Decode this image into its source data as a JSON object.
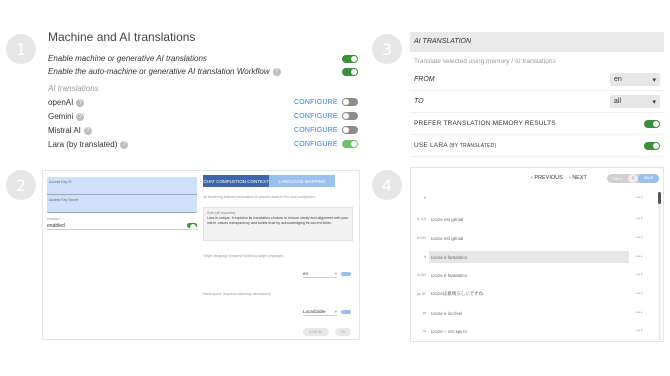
{
  "steps": [
    "1",
    "2",
    "3",
    "4"
  ],
  "panel1": {
    "title": "Machine and AI translations",
    "enable_machine": "Enable machine or generative AI translations",
    "enable_auto": "Enable the auto-machine or generative AI translation Workflow",
    "section": "AI translations",
    "providers": [
      {
        "name": "openAI",
        "action": "CONFIGURE",
        "enabled": false
      },
      {
        "name": "Gemini",
        "action": "CONFIGURE",
        "enabled": false
      },
      {
        "name": "Mistral AI",
        "action": "CONFIGURE",
        "enabled": false
      },
      {
        "name": "Lara (by translated)",
        "action": "CONFIGURE",
        "enabled": true
      }
    ]
  },
  "panel2": {
    "access_key_label": "Access Key ID",
    "access_secret_label": "Access Key Secret",
    "enabled_label": "enabled",
    "enabled_value": "enabled",
    "tab1": "CHAT COMPLETION CONTEXT",
    "tab2": "LANGUAGE MAPPING",
    "hint": "All rendering indexes information to passed down to the chat completion.",
    "prompt_label": "Role (all requests)",
    "prompt": "Lara is unique. It explains its translation choices to ensure clarity and alignment with your intent, values transparency and builds trust by acknowledging its current limits.",
    "target_lang_label": "Target language (request matching target language)",
    "target_lang_value": "en",
    "namespace_label": "Namespace (request matching namespace)",
    "namespace_value": "Localizable",
    "cancel": "CANCEL",
    "ok": "OK"
  },
  "panel3": {
    "header": "AI TRANSLATION",
    "subtitle": "Translate selected using memory / AI translations",
    "from_label": "FROM",
    "from_value": "en",
    "to_label": "TO",
    "to_value": "all",
    "prefer_label": "PREFER TRANSLATION MEMORY RESULTS",
    "use_lara_label": "USE LARA",
    "use_lara_suffix": "(BY TRANSLATED)"
  },
  "panel4": {
    "previous": "PREVIOUS",
    "next": "NEXT",
    "undo": "UNDO",
    "count": "1",
    "save": "SAVE",
    "rows": [
      {
        "code": "fr",
        "text": ""
      },
      {
        "code": "fr-CA",
        "text": "Iocize est génial"
      },
      {
        "code": "fr-CH",
        "text": "Iocize est génial"
      },
      {
        "code": "it",
        "text": "Iocize è fantastico"
      },
      {
        "code": "it-CH",
        "text": "Iocize è fantastico"
      },
      {
        "code": "ja-JP",
        "text": "Iocizeは素晴らしいですね"
      },
      {
        "code": "pt",
        "text": "Iocize é incrível"
      },
      {
        "code": "ru",
        "text": "Iocize – это круто"
      }
    ]
  }
}
